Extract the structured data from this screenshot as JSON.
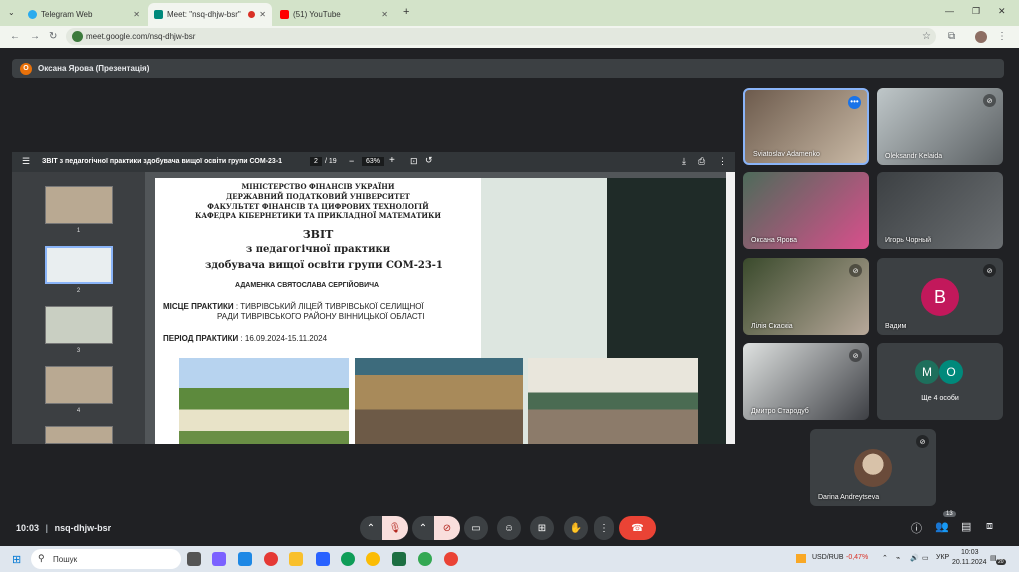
{
  "browser": {
    "tabs": [
      {
        "label": "Telegram Web",
        "color": "#2aabee"
      },
      {
        "label": "Meet: \"nsq-dhjw-bsr\"",
        "color": "#00897b"
      },
      {
        "label": "(51) YouTube",
        "color": "#ff0000"
      }
    ],
    "url": "meet.google.com/nsq-dhjw-bsr",
    "new_tab": "+"
  },
  "meet": {
    "presenter_initial": "О",
    "presenter_label": "Оксана Ярова (Презентація)",
    "meeting_time": "10:03",
    "meeting_code": "nsq-dhjw-bsr",
    "participants_count": "13"
  },
  "pdf": {
    "title": "ЗВІТ з педагогічної практики здобувача вищої освіти групи СОМ-23-1",
    "page_current": "2",
    "page_total": "/ 19",
    "zoom": "63%",
    "thumb_numbers": [
      "1",
      "2",
      "3",
      "4"
    ],
    "page": {
      "line1": "МІНІСТЕРСТВО ФІНАНСІВ УКРАЇНИ",
      "line2": "ДЕРЖАВНИЙ ПОДАТКОВИЙ УНІВЕРСИТЕТ",
      "line3": "ФАКУЛЬТЕТ ФІНАНСІВ ТА ЦИФРОВИХ ТЕХНОЛОГІЙ",
      "line4": "КАФЕДРА КІБЕРНЕТИКИ ТА ПРИКЛАДНОЇ МАТЕМАТИКИ",
      "title1": "ЗВІТ",
      "title2": "з педагогічної практики",
      "title3": "здобувача вищої освіти групи СОМ-23-1",
      "student": "АДАМЕНКА СВЯТОСЛАВА СЕРГІЙОВИЧА",
      "place_label": "МІСЦЕ ПРАКТИКИ",
      "place_value1": ": ТИВРІВСЬКИЙ ЛІЦЕЙ ТИВРІВСЬКОЇ СЕЛИЩНОЇ",
      "place_value2": "РАДИ ТИВРІВСЬКОГО РАЙОНУ ВІННИЦЬКОЇ ОБЛАСТІ",
      "period_label": "ПЕРІОД ПРАКТИКИ",
      "period_value": ": 16.09.2024-15.11.2024"
    }
  },
  "participants": [
    {
      "name": "Sviatoslav Adamenko"
    },
    {
      "name": "Oleksandr Kelaida"
    },
    {
      "name": "Оксана Ярова"
    },
    {
      "name": "Игорь Чорный"
    },
    {
      "name": "Лілія Скаскіа"
    },
    {
      "name": "Вадим",
      "initial": "B",
      "color": "#c2185b"
    },
    {
      "name": "Дмитро Стародуб"
    },
    {
      "name": "Ще 4 особи",
      "initials": [
        "M",
        "O"
      ]
    },
    {
      "name": "Darina Andreytseva"
    }
  ],
  "taskbar": {
    "search": "Пошук",
    "ticker_label": "USD/RUB",
    "ticker_value": "-0,47%",
    "lang": "УКР",
    "clock_time": "10:03",
    "clock_date": "20.11.2024",
    "notif_count": "20"
  }
}
